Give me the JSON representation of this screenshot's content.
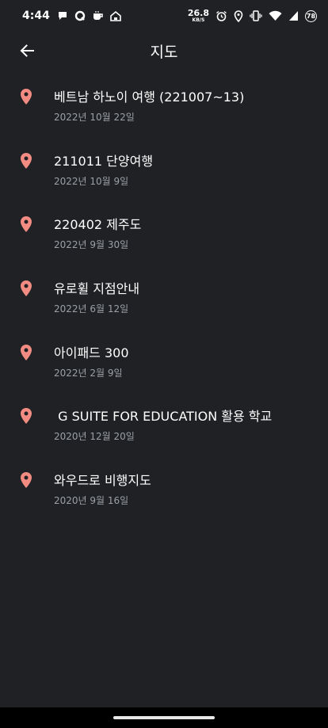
{
  "status_bar": {
    "time": "4:44",
    "net_speed": "26.8",
    "net_unit": "KB/S",
    "battery": "78"
  },
  "app_bar": {
    "title": "지도"
  },
  "colors": {
    "background": "#202124",
    "pin": "#f28b82",
    "secondary_text": "#9aa0a6"
  },
  "maps": [
    {
      "title": "베트남 하노이 여행 (221007~13)",
      "date": "2022년 10월 22일"
    },
    {
      "title": "211011 단양여행",
      "date": "2022년 10월 9일"
    },
    {
      "title": "220402 제주도",
      "date": "2022년 9월 30일"
    },
    {
      "title": "유로휠 지점안내",
      "date": "2022년 6월 12일"
    },
    {
      "title": "아이패드 300",
      "date": "2022년 2월 9일"
    },
    {
      "title": " G SUITE FOR EDUCATION 활용 학교",
      "date": "2020년 12월 20일"
    },
    {
      "title": "와우드로 비행지도",
      "date": "2020년 9월 16일"
    }
  ]
}
